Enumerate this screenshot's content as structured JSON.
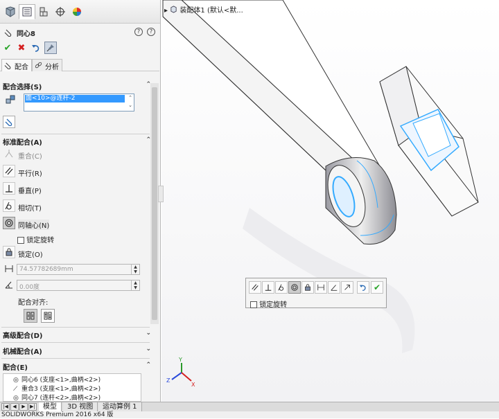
{
  "pm": {
    "tabs": [
      "featuremanager-icon",
      "propertymanager-icon",
      "configmanager-icon",
      "dimxpert-icon",
      "display-manager-icon"
    ],
    "title": "同心8",
    "help_q": "?",
    "subtabs": {
      "mates_label": "配合",
      "analysis_label": "分析"
    },
    "mate_selections": {
      "header": "配合选择(S)",
      "item": "面<10>@连杆-2"
    },
    "standard": {
      "header": "标准配合(A)",
      "coincident": "重合(C)",
      "parallel": "平行(R)",
      "perpendicular": "垂直(P)",
      "tangent": "相切(T)",
      "concentric": "同轴心(N)",
      "lock_rotation": "锁定旋转",
      "lock": "锁定(O)",
      "distance_value": "74.57782689mm",
      "angle_value": "0.00度",
      "alignment_label": "配合对齐:"
    },
    "advanced_header": "高级配合(D)",
    "mechanical_header": "机械配合(A)",
    "mates_header": "配合(E)",
    "mates_list": [
      {
        "label": "同心6 (支座<1>,曲柄<2>)",
        "icon": "concentric-icon"
      },
      {
        "label": "重合3 (支座<1>,曲柄<2>)",
        "icon": "coincident-icon"
      },
      {
        "label": "同心7 (连杆<2>,曲柄<2>)",
        "icon": "concentric-icon"
      }
    ]
  },
  "graphics": {
    "breadcrumb": "装配体1 (默认<默...",
    "context_toolbar": {
      "lock_rotation": "锁定旋转"
    },
    "triad": {
      "x": "X",
      "y": "Y",
      "z": "Z"
    }
  },
  "bottom": {
    "tabs": [
      "模型",
      "3D 视图",
      "运动算例 1"
    ],
    "status": "SOLIDWORKS Premium 2016 x64 版"
  },
  "colors": {
    "accent_selection": "#3399ff",
    "ok_green": "#2aa52a",
    "cancel_red": "#d42020",
    "highlight_cyan": "#33aaff"
  }
}
